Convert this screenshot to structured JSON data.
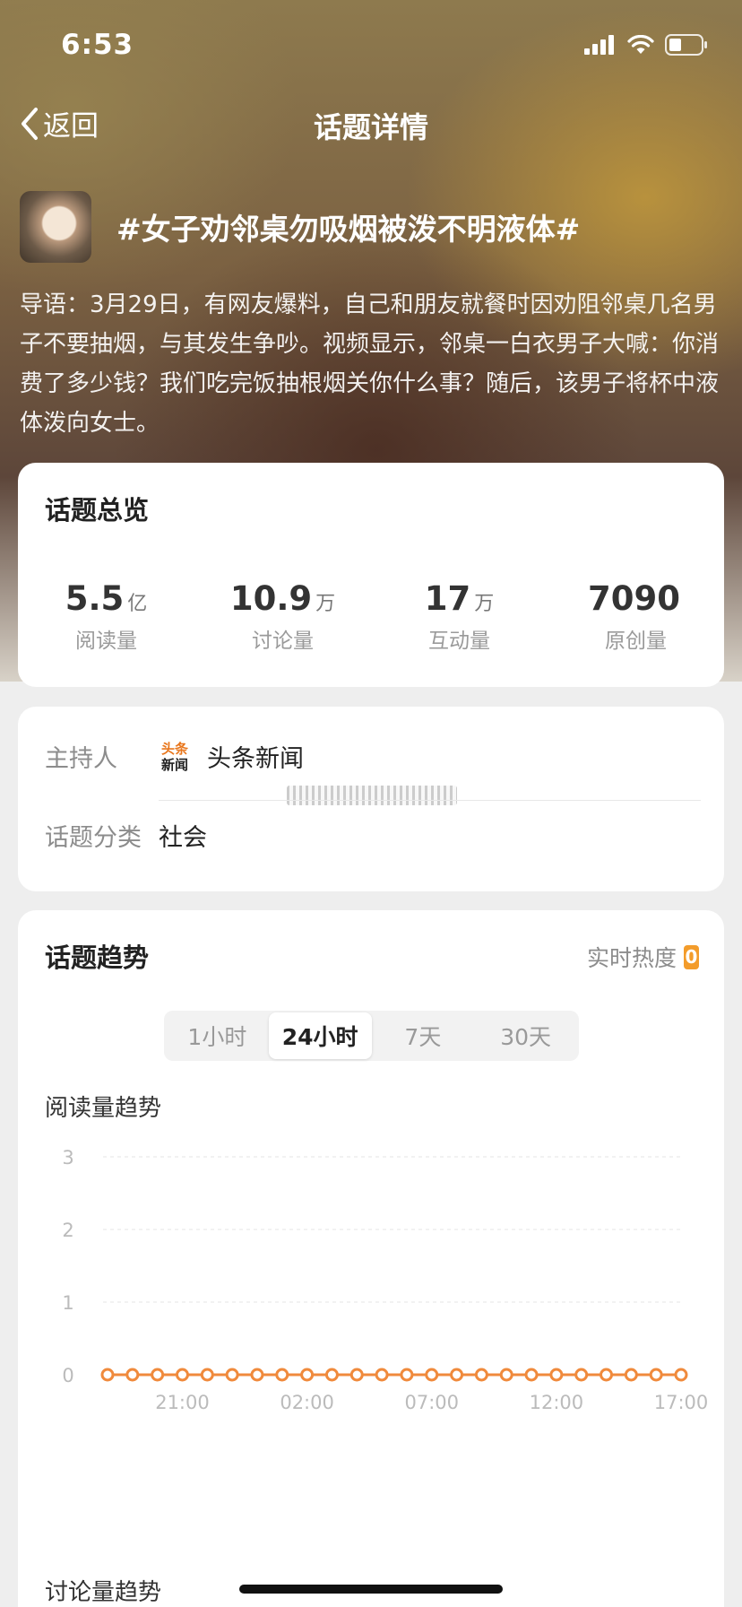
{
  "status_bar": {
    "time": "6:53"
  },
  "nav": {
    "back_label": "返回",
    "title": "话题详情"
  },
  "topic": {
    "title": "#女子劝邻桌勿吸烟被泼不明液体#",
    "intro": "导语：3月29日，有网友爆料，自己和朋友就餐时因劝阻邻桌几名男子不要抽烟，与其发生争吵。视频显示，邻桌一白衣男子大喊：你消费了多少钱？我们吃完饭抽根烟关你什么事？随后，该男子将杯中液体泼向女士。"
  },
  "overview": {
    "title": "话题总览",
    "stats": [
      {
        "value": "5.5",
        "unit": "亿",
        "label": "阅读量"
      },
      {
        "value": "10.9",
        "unit": "万",
        "label": "讨论量"
      },
      {
        "value": "17",
        "unit": "万",
        "label": "互动量"
      },
      {
        "value": "7090",
        "unit": "",
        "label": "原创量"
      }
    ]
  },
  "info": {
    "host_label": "主持人",
    "host_logo_text_top": "头条",
    "host_logo_text_bottom": "新闻",
    "host_name": "头条新闻",
    "category_label": "话题分类",
    "category_value": "社会"
  },
  "trend": {
    "title": "话题趋势",
    "realtime_label": "实时热度",
    "realtime_value": "0",
    "tabs": [
      {
        "label": "1小时",
        "active": false
      },
      {
        "label": "24小时",
        "active": true
      },
      {
        "label": "7天",
        "active": false
      },
      {
        "label": "30天",
        "active": false
      }
    ],
    "read_trend_title": "阅读量趋势",
    "discuss_trend_title": "讨论量趋势"
  },
  "colors": {
    "accent": "#f08a3c",
    "heat": "#f39c2b"
  },
  "chart_data": {
    "type": "line",
    "title": "阅读量趋势",
    "xlabel": "",
    "ylabel": "",
    "ylim": [
      0,
      3
    ],
    "y_ticks": [
      0,
      1,
      2,
      3
    ],
    "x_tick_labels": [
      "21:00",
      "02:00",
      "07:00",
      "12:00",
      "17:00"
    ],
    "grid": true,
    "series": [
      {
        "values": [
          0,
          0,
          0,
          0,
          0,
          0,
          0,
          0,
          0,
          0,
          0,
          0,
          0,
          0,
          0,
          0,
          0,
          0,
          0,
          0,
          0,
          0,
          0,
          0
        ]
      }
    ]
  }
}
